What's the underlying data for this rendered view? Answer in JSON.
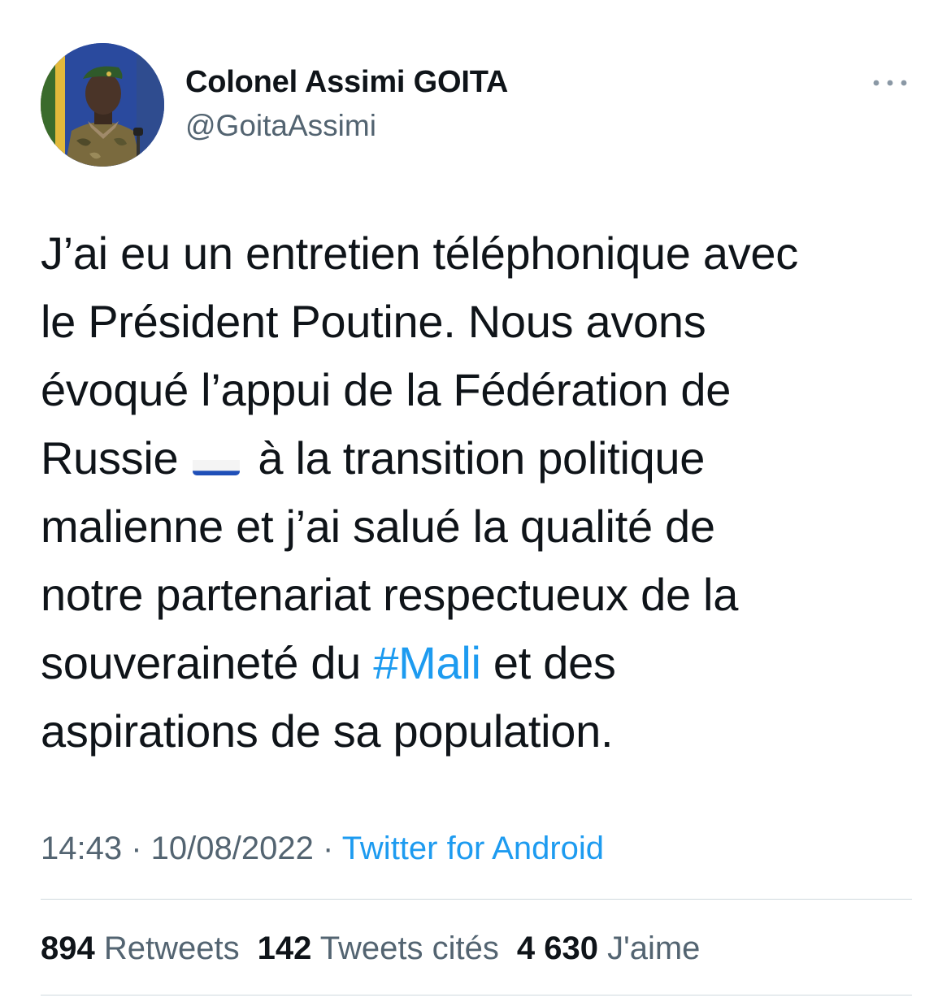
{
  "author": {
    "display_name": "Colonel Assimi GOITA",
    "handle": "@GoitaAssimi"
  },
  "icons": {
    "more": "more-horizontal-icon",
    "flag": "russia-flag-emoji"
  },
  "tweet": {
    "line1": "J’ai eu un entretien téléphonique avec",
    "line2": "le Président Poutine. Nous avons",
    "line3": "évoqué l’appui de la Fédération de",
    "line4_before_flag": "Russie",
    "line4_after_flag": "à la transition politique",
    "line5": "malienne et j’ai salué la qualité de",
    "line6": "notre partenariat respectueux de la",
    "line7_before_hashtag": "souveraineté du ",
    "hashtag": "#Mali",
    "line7_after_hashtag": " et des",
    "line8": "aspirations de sa population."
  },
  "meta": {
    "time": "14:43",
    "separator1": " · ",
    "date": "10/08/2022",
    "separator2": " · ",
    "source": "Twitter for Android"
  },
  "stats": {
    "retweets_count": "894",
    "retweets_label": "Retweets",
    "quotes_count": "142",
    "quotes_label": "Tweets cités",
    "likes_count": "4 630",
    "likes_label": "J'aime"
  },
  "colors": {
    "text": "#0f1419",
    "secondary": "#536471",
    "link": "#1d9bf0",
    "divider": "#cfd9de"
  }
}
